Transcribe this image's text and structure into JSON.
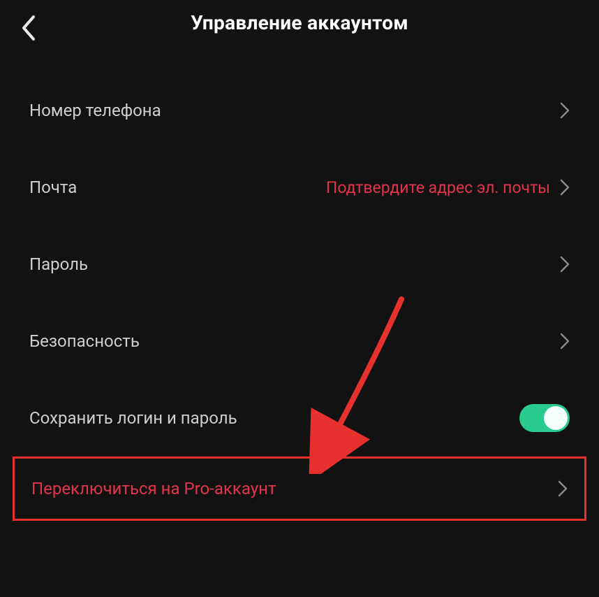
{
  "header": {
    "title": "Управление аккаунтом"
  },
  "rows": {
    "phone": {
      "label": "Номер телефона"
    },
    "email": {
      "label": "Почта",
      "status": "Подтвердите адрес эл. почты"
    },
    "password": {
      "label": "Пароль"
    },
    "security": {
      "label": "Безопасность"
    },
    "saveLogin": {
      "label": "Сохранить логин и пароль",
      "toggleOn": true
    },
    "proAccount": {
      "label": "Переключиться на Pro-аккаунт"
    }
  },
  "colors": {
    "accent": "#e1344b",
    "toggleOn": "#29cc8e",
    "highlight": "#e7312f"
  }
}
